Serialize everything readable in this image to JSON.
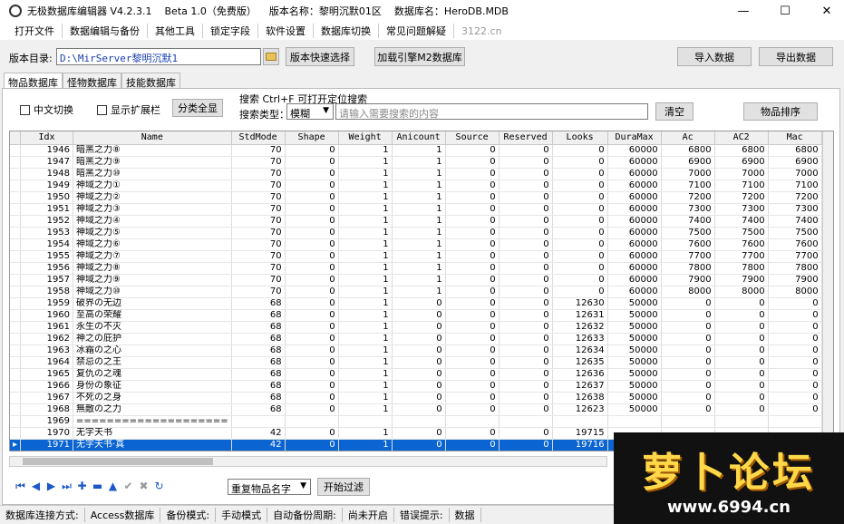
{
  "title": {
    "app_name": "无极数据库编辑器 V4.2.3.1",
    "beta": "Beta 1.0（免费版）",
    "version_name": "版本名称：黎明沉默01区",
    "database_name": "数据库名：HeroDB.MDB"
  },
  "window_controls": {
    "minimize": "—",
    "maximize": "☐",
    "close": "✕"
  },
  "menu": [
    "打开文件",
    "数据编辑与备份",
    "其他工具",
    "锁定字段",
    "软件设置",
    "数据库切换",
    "常见问题解疑"
  ],
  "menu_extra": "3122.cn",
  "dir": {
    "label": "版本目录:",
    "value": "D:\\MirServer黎明沉默1",
    "quick_select": "版本快速选择",
    "load_engine": "加载引擎M2数据库",
    "import": "导入数据",
    "export": "导出数据"
  },
  "tabs": [
    "物品数据库",
    "怪物数据库",
    "技能数据库"
  ],
  "filters": {
    "chinese_switch": "中文切换",
    "show_extended": "显示扩展栏",
    "show_all_categories": "分类全显",
    "search_label": "搜索  Ctrl+F 可打开定位搜索",
    "search_type_label": "搜索类型：",
    "search_type_value": "模糊",
    "search_placeholder": "请输入需要搜索的内容",
    "clear": "清空",
    "sort_items": "物品排序"
  },
  "columns": [
    "Idx",
    "Name",
    "StdMode",
    "Shape",
    "Weight",
    "Anicount",
    "Source",
    "Reserved",
    "Looks",
    "DuraMax",
    "Ac",
    "AC2",
    "Mac"
  ],
  "rows": [
    [
      "1946",
      "暗黑之力⑧",
      "70",
      "0",
      "1",
      "1",
      "0",
      "0",
      "0",
      "60000",
      "6800",
      "6800",
      "6800"
    ],
    [
      "1947",
      "暗黑之力⑨",
      "70",
      "0",
      "1",
      "1",
      "0",
      "0",
      "0",
      "60000",
      "6900",
      "6900",
      "6900"
    ],
    [
      "1948",
      "暗黑之力⑩",
      "70",
      "0",
      "1",
      "1",
      "0",
      "0",
      "0",
      "60000",
      "7000",
      "7000",
      "7000"
    ],
    [
      "1949",
      "神域之力①",
      "70",
      "0",
      "1",
      "1",
      "0",
      "0",
      "0",
      "60000",
      "7100",
      "7100",
      "7100"
    ],
    [
      "1950",
      "神域之力②",
      "70",
      "0",
      "1",
      "1",
      "0",
      "0",
      "0",
      "60000",
      "7200",
      "7200",
      "7200"
    ],
    [
      "1951",
      "神域之力③",
      "70",
      "0",
      "1",
      "1",
      "0",
      "0",
      "0",
      "60000",
      "7300",
      "7300",
      "7300"
    ],
    [
      "1952",
      "神域之力④",
      "70",
      "0",
      "1",
      "1",
      "0",
      "0",
      "0",
      "60000",
      "7400",
      "7400",
      "7400"
    ],
    [
      "1953",
      "神域之力⑤",
      "70",
      "0",
      "1",
      "1",
      "0",
      "0",
      "0",
      "60000",
      "7500",
      "7500",
      "7500"
    ],
    [
      "1954",
      "神域之力⑥",
      "70",
      "0",
      "1",
      "1",
      "0",
      "0",
      "0",
      "60000",
      "7600",
      "7600",
      "7600"
    ],
    [
      "1955",
      "神域之力⑦",
      "70",
      "0",
      "1",
      "1",
      "0",
      "0",
      "0",
      "60000",
      "7700",
      "7700",
      "7700"
    ],
    [
      "1956",
      "神域之力⑧",
      "70",
      "0",
      "1",
      "1",
      "0",
      "0",
      "0",
      "60000",
      "7800",
      "7800",
      "7800"
    ],
    [
      "1957",
      "神域之力⑨",
      "70",
      "0",
      "1",
      "1",
      "0",
      "0",
      "0",
      "60000",
      "7900",
      "7900",
      "7900"
    ],
    [
      "1958",
      "神域之力⑩",
      "70",
      "0",
      "1",
      "1",
      "0",
      "0",
      "0",
      "60000",
      "8000",
      "8000",
      "8000"
    ],
    [
      "1959",
      "破界の无边",
      "68",
      "0",
      "1",
      "0",
      "0",
      "0",
      "12630",
      "50000",
      "0",
      "0",
      "0"
    ],
    [
      "1960",
      "至高の荣耀",
      "68",
      "0",
      "1",
      "0",
      "0",
      "0",
      "12631",
      "50000",
      "0",
      "0",
      "0"
    ],
    [
      "1961",
      "永生の不灭",
      "68",
      "0",
      "1",
      "0",
      "0",
      "0",
      "12632",
      "50000",
      "0",
      "0",
      "0"
    ],
    [
      "1962",
      "神之の庇护",
      "68",
      "0",
      "1",
      "0",
      "0",
      "0",
      "12633",
      "50000",
      "0",
      "0",
      "0"
    ],
    [
      "1963",
      "冰霜の之心",
      "68",
      "0",
      "1",
      "0",
      "0",
      "0",
      "12634",
      "50000",
      "0",
      "0",
      "0"
    ],
    [
      "1964",
      "禁忌の之王",
      "68",
      "0",
      "1",
      "0",
      "0",
      "0",
      "12635",
      "50000",
      "0",
      "0",
      "0"
    ],
    [
      "1965",
      "复仇の之魂",
      "68",
      "0",
      "1",
      "0",
      "0",
      "0",
      "12636",
      "50000",
      "0",
      "0",
      "0"
    ],
    [
      "1966",
      "身份の象征",
      "68",
      "0",
      "1",
      "0",
      "0",
      "0",
      "12637",
      "50000",
      "0",
      "0",
      "0"
    ],
    [
      "1967",
      "不死の之身",
      "68",
      "0",
      "1",
      "0",
      "0",
      "0",
      "12638",
      "50000",
      "0",
      "0",
      "0"
    ],
    [
      "1968",
      "無敵の之力",
      "68",
      "0",
      "1",
      "0",
      "0",
      "0",
      "12623",
      "50000",
      "0",
      "0",
      "0"
    ],
    [
      "1969",
      "====================",
      "",
      "",
      "",
      "",
      "",
      "",
      "",
      "",
      "",
      "",
      ""
    ],
    [
      "1970",
      "无字天书",
      "42",
      "0",
      "1",
      "0",
      "0",
      "0",
      "19715",
      "",
      "",
      "",
      ""
    ],
    [
      "1971",
      "无字天书·真",
      "42",
      "0",
      "1",
      "0",
      "0",
      "0",
      "19716",
      "",
      "",
      "",
      ""
    ]
  ],
  "selected_row_index": 25,
  "bottom": {
    "dup_names": "重复物品名字",
    "start_filter": "开始过滤",
    "nav_icons": [
      "first-icon",
      "prior-icon",
      "next-icon",
      "last-icon",
      "insert-icon",
      "delete-icon",
      "edit-icon",
      "post-icon",
      "cancel-icon",
      "refresh-icon"
    ]
  },
  "status": [
    "数据库连接方式:",
    "Access数据库",
    "备份模式:",
    "手动模式",
    "自动备份周期:",
    "尚未开启",
    "错误提示:",
    "数据"
  ],
  "logo": {
    "text": "萝卜论坛",
    "url": "www.6994.cn"
  }
}
